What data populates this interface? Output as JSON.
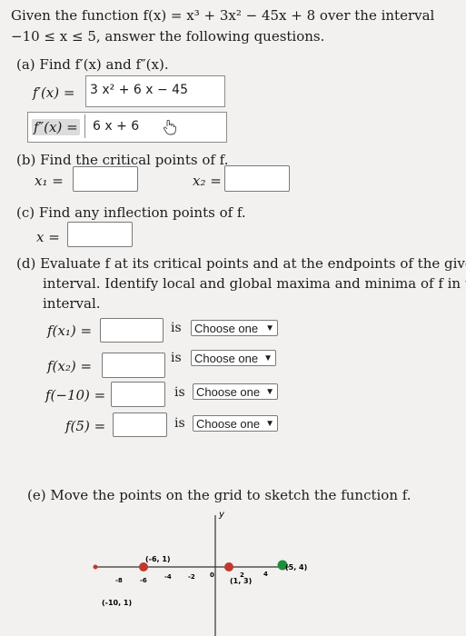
{
  "intro": {
    "line1": "Given the function f(x) = x³ + 3x² − 45x + 8 over the interval",
    "line2": "−10 ≤ x ≤ 5, answer the following questions."
  },
  "part_a": {
    "prompt": "(a) Find f′(x) and f″(x).",
    "fprime_label": "f′(x) =",
    "fprime_value": "3 x² + 6 x − 45",
    "fdouble_label": "f″(x) =",
    "fdouble_value": "6 x + 6"
  },
  "part_b": {
    "prompt": "(b) Find the critical points of f.",
    "x1_label": "x₁ =",
    "x2_label": "x₂ ="
  },
  "part_c": {
    "prompt": "(c) Find any inflection points of f.",
    "x_label": "x ="
  },
  "part_d": {
    "line1": "(d) Evaluate f at its critical points and at the endpoints of the given",
    "line2": "interval. Identify local and global maxima and minima of f in the",
    "line3": "interval.",
    "is_word": "is",
    "rows": [
      {
        "label": "f(x₁) =",
        "select": "Choose one"
      },
      {
        "label": "f(x₂) =",
        "select": "Choose one"
      },
      {
        "label": "f(−10) =",
        "select": "Choose one"
      },
      {
        "label": "f(5) =",
        "select": "Choose one"
      }
    ]
  },
  "part_e": {
    "prompt": "(e) Move the points on the grid to sketch the function f.",
    "graph": {
      "y_axis_label": "y",
      "tick_labels": [
        "-8",
        "-6",
        "-4",
        "-2",
        "0",
        "2",
        "4"
      ],
      "point_labels": [
        "(-6, 1)",
        "(-10, 1)",
        "(1, 3)",
        "(5, 4)"
      ]
    }
  },
  "colors": {
    "point_red": "#c0392b",
    "point_green": "#1e8e3e",
    "axis": "#333333"
  }
}
